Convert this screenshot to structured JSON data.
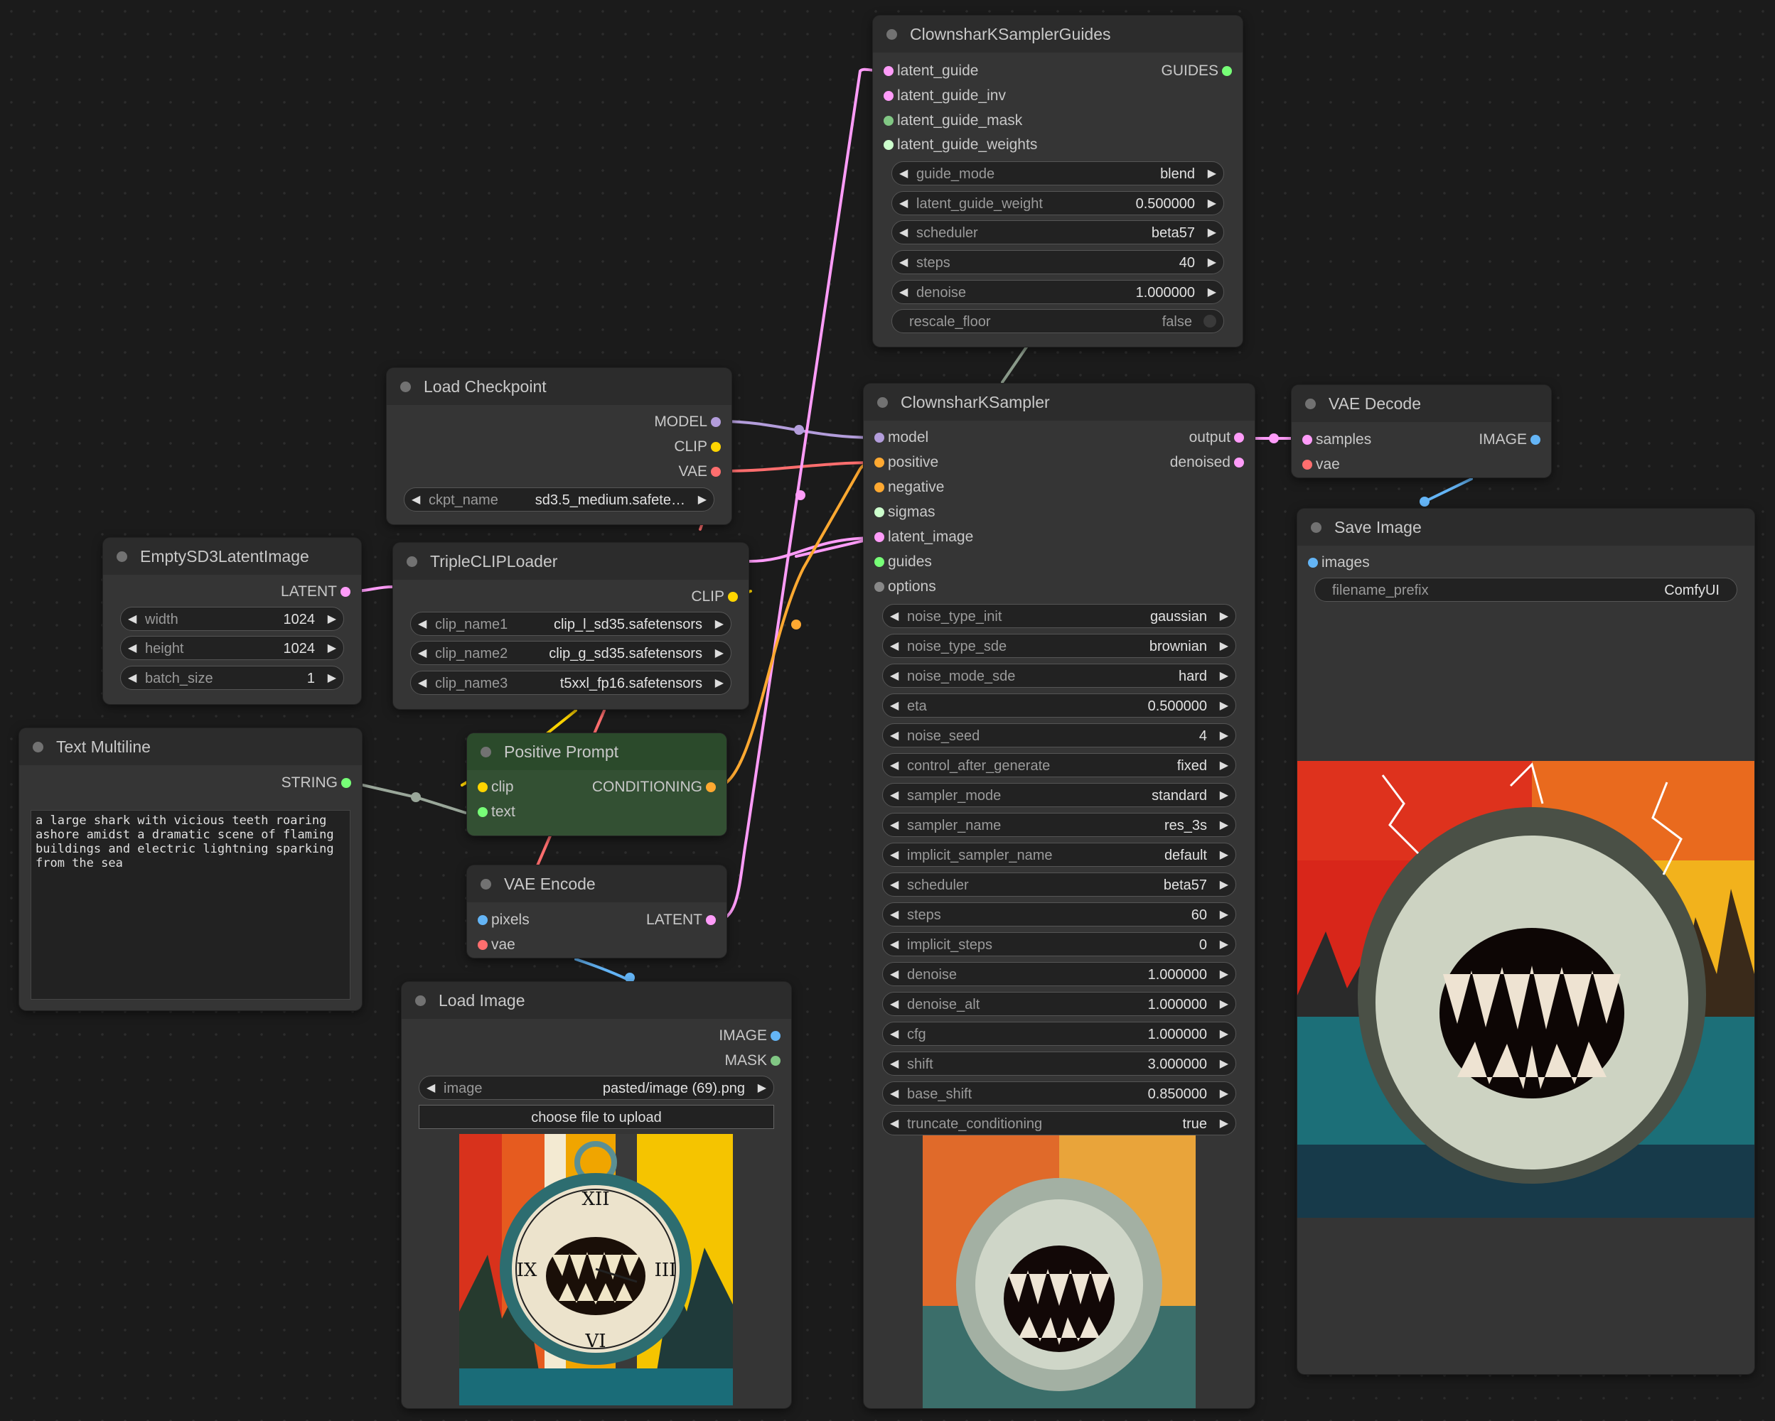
{
  "colors": {
    "model": "#b39ddb",
    "clip": "#ffd500",
    "vae": "#ff6e6e",
    "latent": "#ff9cf9",
    "conditioning": "#ffa931",
    "image": "#64b5f6",
    "mask": "#81c784",
    "string": "#77ff77",
    "guides": "#77ff77",
    "sigmas": "#cdffcd",
    "options": "#888888"
  },
  "nodes": {
    "guides": {
      "title": "ClownsharKSamplerGuides",
      "inputs": [
        "latent_guide",
        "latent_guide_inv",
        "latent_guide_mask",
        "latent_guide_weights"
      ],
      "output": "GUIDES",
      "widgets": [
        {
          "label": "guide_mode",
          "value": "blend"
        },
        {
          "label": "latent_guide_weight",
          "value": "0.500000"
        },
        {
          "label": "scheduler",
          "value": "beta57"
        },
        {
          "label": "steps",
          "value": "40"
        },
        {
          "label": "denoise",
          "value": "1.000000"
        }
      ],
      "toggle": {
        "label": "rescale_floor",
        "value": "false"
      }
    },
    "checkpoint": {
      "title": "Load Checkpoint",
      "outputs": [
        "MODEL",
        "CLIP",
        "VAE"
      ],
      "widget": {
        "label": "ckpt_name",
        "value": "sd3.5_medium.safete…"
      }
    },
    "latent": {
      "title": "EmptySD3LatentImage",
      "output": "LATENT",
      "widgets": [
        {
          "label": "width",
          "value": "1024"
        },
        {
          "label": "height",
          "value": "1024"
        },
        {
          "label": "batch_size",
          "value": "1"
        }
      ]
    },
    "tripleclip": {
      "title": "TripleCLIPLoader",
      "output": "CLIP",
      "widgets": [
        {
          "label": "clip_name1",
          "value": "clip_l_sd35.safetensors"
        },
        {
          "label": "clip_name2",
          "value": "clip_g_sd35.safetensors"
        },
        {
          "label": "clip_name3",
          "value": "t5xxl_fp16.safetensors"
        }
      ]
    },
    "text": {
      "title": "Text Multiline",
      "output": "STRING",
      "value": "a large shark with vicious teeth roaring ashore amidst a dramatic scene of flaming buildings and electric lightning sparking from the sea"
    },
    "prompt": {
      "title": "Positive Prompt",
      "inputs": [
        "clip",
        "text"
      ],
      "output": "CONDITIONING"
    },
    "vaeencode": {
      "title": "VAE Encode",
      "inputs": [
        "pixels",
        "vae"
      ],
      "output": "LATENT"
    },
    "loadimage": {
      "title": "Load Image",
      "outputs": [
        "IMAGE",
        "MASK"
      ],
      "widget": {
        "label": "image",
        "value": "pasted/image (69).png"
      },
      "button": "choose file to upload"
    },
    "sampler": {
      "title": "ClownsharKSampler",
      "inputs": [
        "model",
        "positive",
        "negative",
        "sigmas",
        "latent_image",
        "guides",
        "options"
      ],
      "outputs": [
        "output",
        "denoised"
      ],
      "widgets": [
        {
          "label": "noise_type_init",
          "value": "gaussian"
        },
        {
          "label": "noise_type_sde",
          "value": "brownian"
        },
        {
          "label": "noise_mode_sde",
          "value": "hard"
        },
        {
          "label": "eta",
          "value": "0.500000"
        },
        {
          "label": "noise_seed",
          "value": "4"
        },
        {
          "label": "control_after_generate",
          "value": "fixed"
        },
        {
          "label": "sampler_mode",
          "value": "standard"
        },
        {
          "label": "sampler_name",
          "value": "res_3s"
        },
        {
          "label": "implicit_sampler_name",
          "value": "default"
        },
        {
          "label": "scheduler",
          "value": "beta57"
        },
        {
          "label": "steps",
          "value": "60"
        },
        {
          "label": "implicit_steps",
          "value": "0"
        },
        {
          "label": "denoise",
          "value": "1.000000"
        },
        {
          "label": "denoise_alt",
          "value": "1.000000"
        },
        {
          "label": "cfg",
          "value": "1.000000"
        },
        {
          "label": "shift",
          "value": "3.000000"
        },
        {
          "label": "base_shift",
          "value": "0.850000"
        },
        {
          "label": "truncate_conditioning",
          "value": "true"
        }
      ]
    },
    "vaedecode": {
      "title": "VAE Decode",
      "inputs": [
        "samples",
        "vae"
      ],
      "output": "IMAGE"
    },
    "save": {
      "title": "Save Image",
      "input": "images",
      "widget": {
        "label": "filename_prefix",
        "value": "ComfyUI"
      }
    }
  }
}
